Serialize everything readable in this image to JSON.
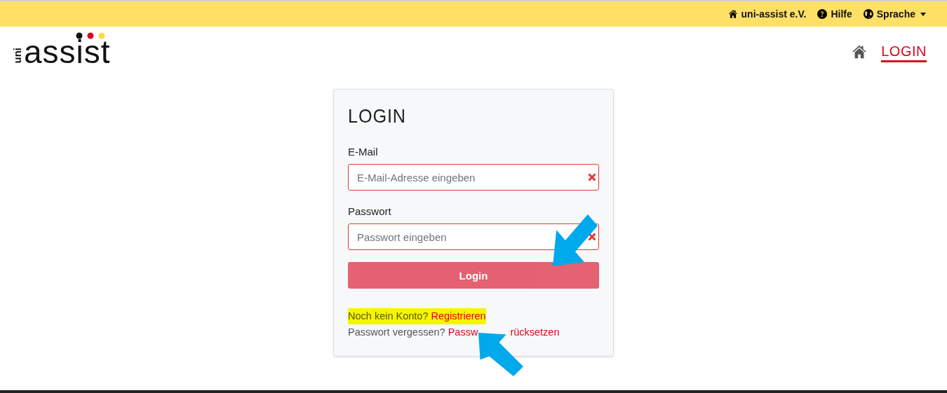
{
  "top_bar": {
    "links": [
      {
        "kind": "home",
        "label": "uni-assist e.V.",
        "dropdown": false
      },
      {
        "kind": "help",
        "label": "Hilfe",
        "dropdown": false
      },
      {
        "kind": "globe",
        "label": "Sprache",
        "dropdown": true
      }
    ]
  },
  "header": {
    "logo": {
      "vertical": "uni",
      "word": "assist"
    },
    "nav": [
      {
        "kind": "home",
        "selected": false
      },
      {
        "kind": "text",
        "label": "LOGIN",
        "selected": true
      }
    ]
  },
  "login_card": {
    "title": "LOGIN",
    "fields": [
      {
        "label": "E-Mail",
        "placeholder": "E-Mail-Adresse eingeben",
        "invalid": true
      },
      {
        "label": "Passwort",
        "placeholder": "Passwort eingeben",
        "invalid": true
      }
    ],
    "button": {
      "label": "Login",
      "disabled": true
    },
    "register_line": {
      "text": "Noch kein Konto?",
      "link": "Registrieren",
      "highlighted": true
    },
    "reset_line": {
      "text": "Passwort vergessen?",
      "link_parts": [
        "Passw",
        "rücksetzen"
      ]
    }
  },
  "annotation_arrows": [
    {
      "kind": "downleft"
    },
    {
      "kind": "upleft"
    }
  ]
}
